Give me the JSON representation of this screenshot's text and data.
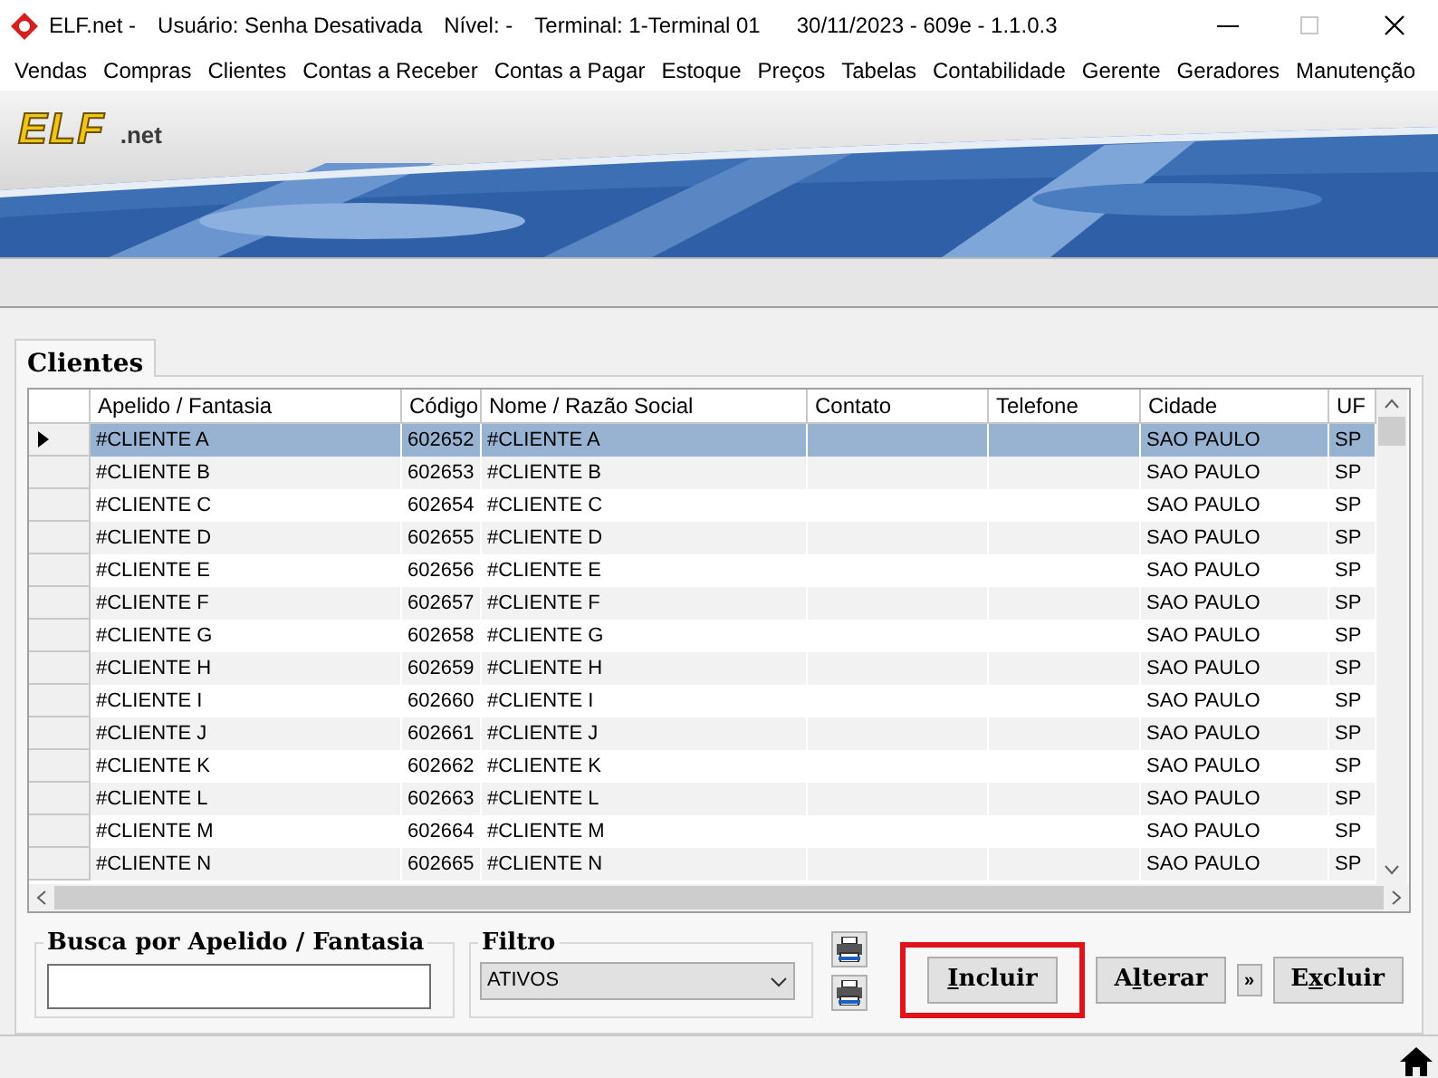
{
  "window": {
    "title_parts": [
      "ELF.net -",
      "Usuário: Senha Desativada",
      "Nível: -",
      "Terminal: 1-Terminal 01",
      "30/11/2023 - 609e - 1.1.0.3"
    ]
  },
  "menu": [
    "Vendas",
    "Compras",
    "Clientes",
    "Contas a Receber",
    "Contas a Pagar",
    "Estoque",
    "Preços",
    "Tabelas",
    "Contabilidade",
    "Gerente",
    "Geradores",
    "Manutenção"
  ],
  "banner": {
    "logo": "ELF",
    "logo_suffix": ".net"
  },
  "tabs": [
    {
      "label": "Clientes",
      "selected": true
    }
  ],
  "table": {
    "columns": [
      "Apelido / Fantasia",
      "Código",
      "Nome / Razão Social",
      "Contato",
      "Telefone",
      "Cidade",
      "UF"
    ],
    "rows": [
      {
        "selected": true,
        "cells": [
          "#CLIENTE A",
          "602652",
          "#CLIENTE A",
          "",
          "",
          "SAO PAULO",
          "SP"
        ]
      },
      {
        "selected": false,
        "cells": [
          "#CLIENTE B",
          "602653",
          "#CLIENTE B",
          "",
          "",
          "SAO PAULO",
          "SP"
        ]
      },
      {
        "selected": false,
        "cells": [
          "#CLIENTE C",
          "602654",
          "#CLIENTE C",
          "",
          "",
          "SAO PAULO",
          "SP"
        ]
      },
      {
        "selected": false,
        "cells": [
          "#CLIENTE D",
          "602655",
          "#CLIENTE D",
          "",
          "",
          "SAO PAULO",
          "SP"
        ]
      },
      {
        "selected": false,
        "cells": [
          "#CLIENTE E",
          "602656",
          "#CLIENTE E",
          "",
          "",
          "SAO PAULO",
          "SP"
        ]
      },
      {
        "selected": false,
        "cells": [
          "#CLIENTE F",
          "602657",
          "#CLIENTE F",
          "",
          "",
          "SAO PAULO",
          "SP"
        ]
      },
      {
        "selected": false,
        "cells": [
          "#CLIENTE G",
          "602658",
          "#CLIENTE G",
          "",
          "",
          "SAO PAULO",
          "SP"
        ]
      },
      {
        "selected": false,
        "cells": [
          "#CLIENTE H",
          "602659",
          "#CLIENTE H",
          "",
          "",
          "SAO PAULO",
          "SP"
        ]
      },
      {
        "selected": false,
        "cells": [
          "#CLIENTE I",
          "602660",
          "#CLIENTE I",
          "",
          "",
          "SAO PAULO",
          "SP"
        ]
      },
      {
        "selected": false,
        "cells": [
          "#CLIENTE J",
          "602661",
          "#CLIENTE J",
          "",
          "",
          "SAO PAULO",
          "SP"
        ]
      },
      {
        "selected": false,
        "cells": [
          "#CLIENTE K",
          "602662",
          "#CLIENTE K",
          "",
          "",
          "SAO PAULO",
          "SP"
        ]
      },
      {
        "selected": false,
        "cells": [
          "#CLIENTE L",
          "602663",
          "#CLIENTE L",
          "",
          "",
          "SAO PAULO",
          "SP"
        ]
      },
      {
        "selected": false,
        "cells": [
          "#CLIENTE M",
          "602664",
          "#CLIENTE M",
          "",
          "",
          "SAO PAULO",
          "SP"
        ]
      },
      {
        "selected": false,
        "cells": [
          "#CLIENTE N",
          "602665",
          "#CLIENTE N",
          "",
          "",
          "SAO PAULO",
          "SP"
        ]
      }
    ]
  },
  "search": {
    "label": "Busca por Apelido / Fantasia"
  },
  "filter": {
    "label": "Filtro",
    "value": "ATIVOS"
  },
  "buttons": [
    {
      "key": "I",
      "post": "ncluir",
      "highlighted": true
    },
    {
      "pre": "A",
      "key": "l",
      "post": "terar",
      "highlighted": false
    },
    {
      "kind": "more",
      "label": "»"
    },
    {
      "pre": "E",
      "key": "x",
      "post": "cluir",
      "highlighted": false
    }
  ]
}
